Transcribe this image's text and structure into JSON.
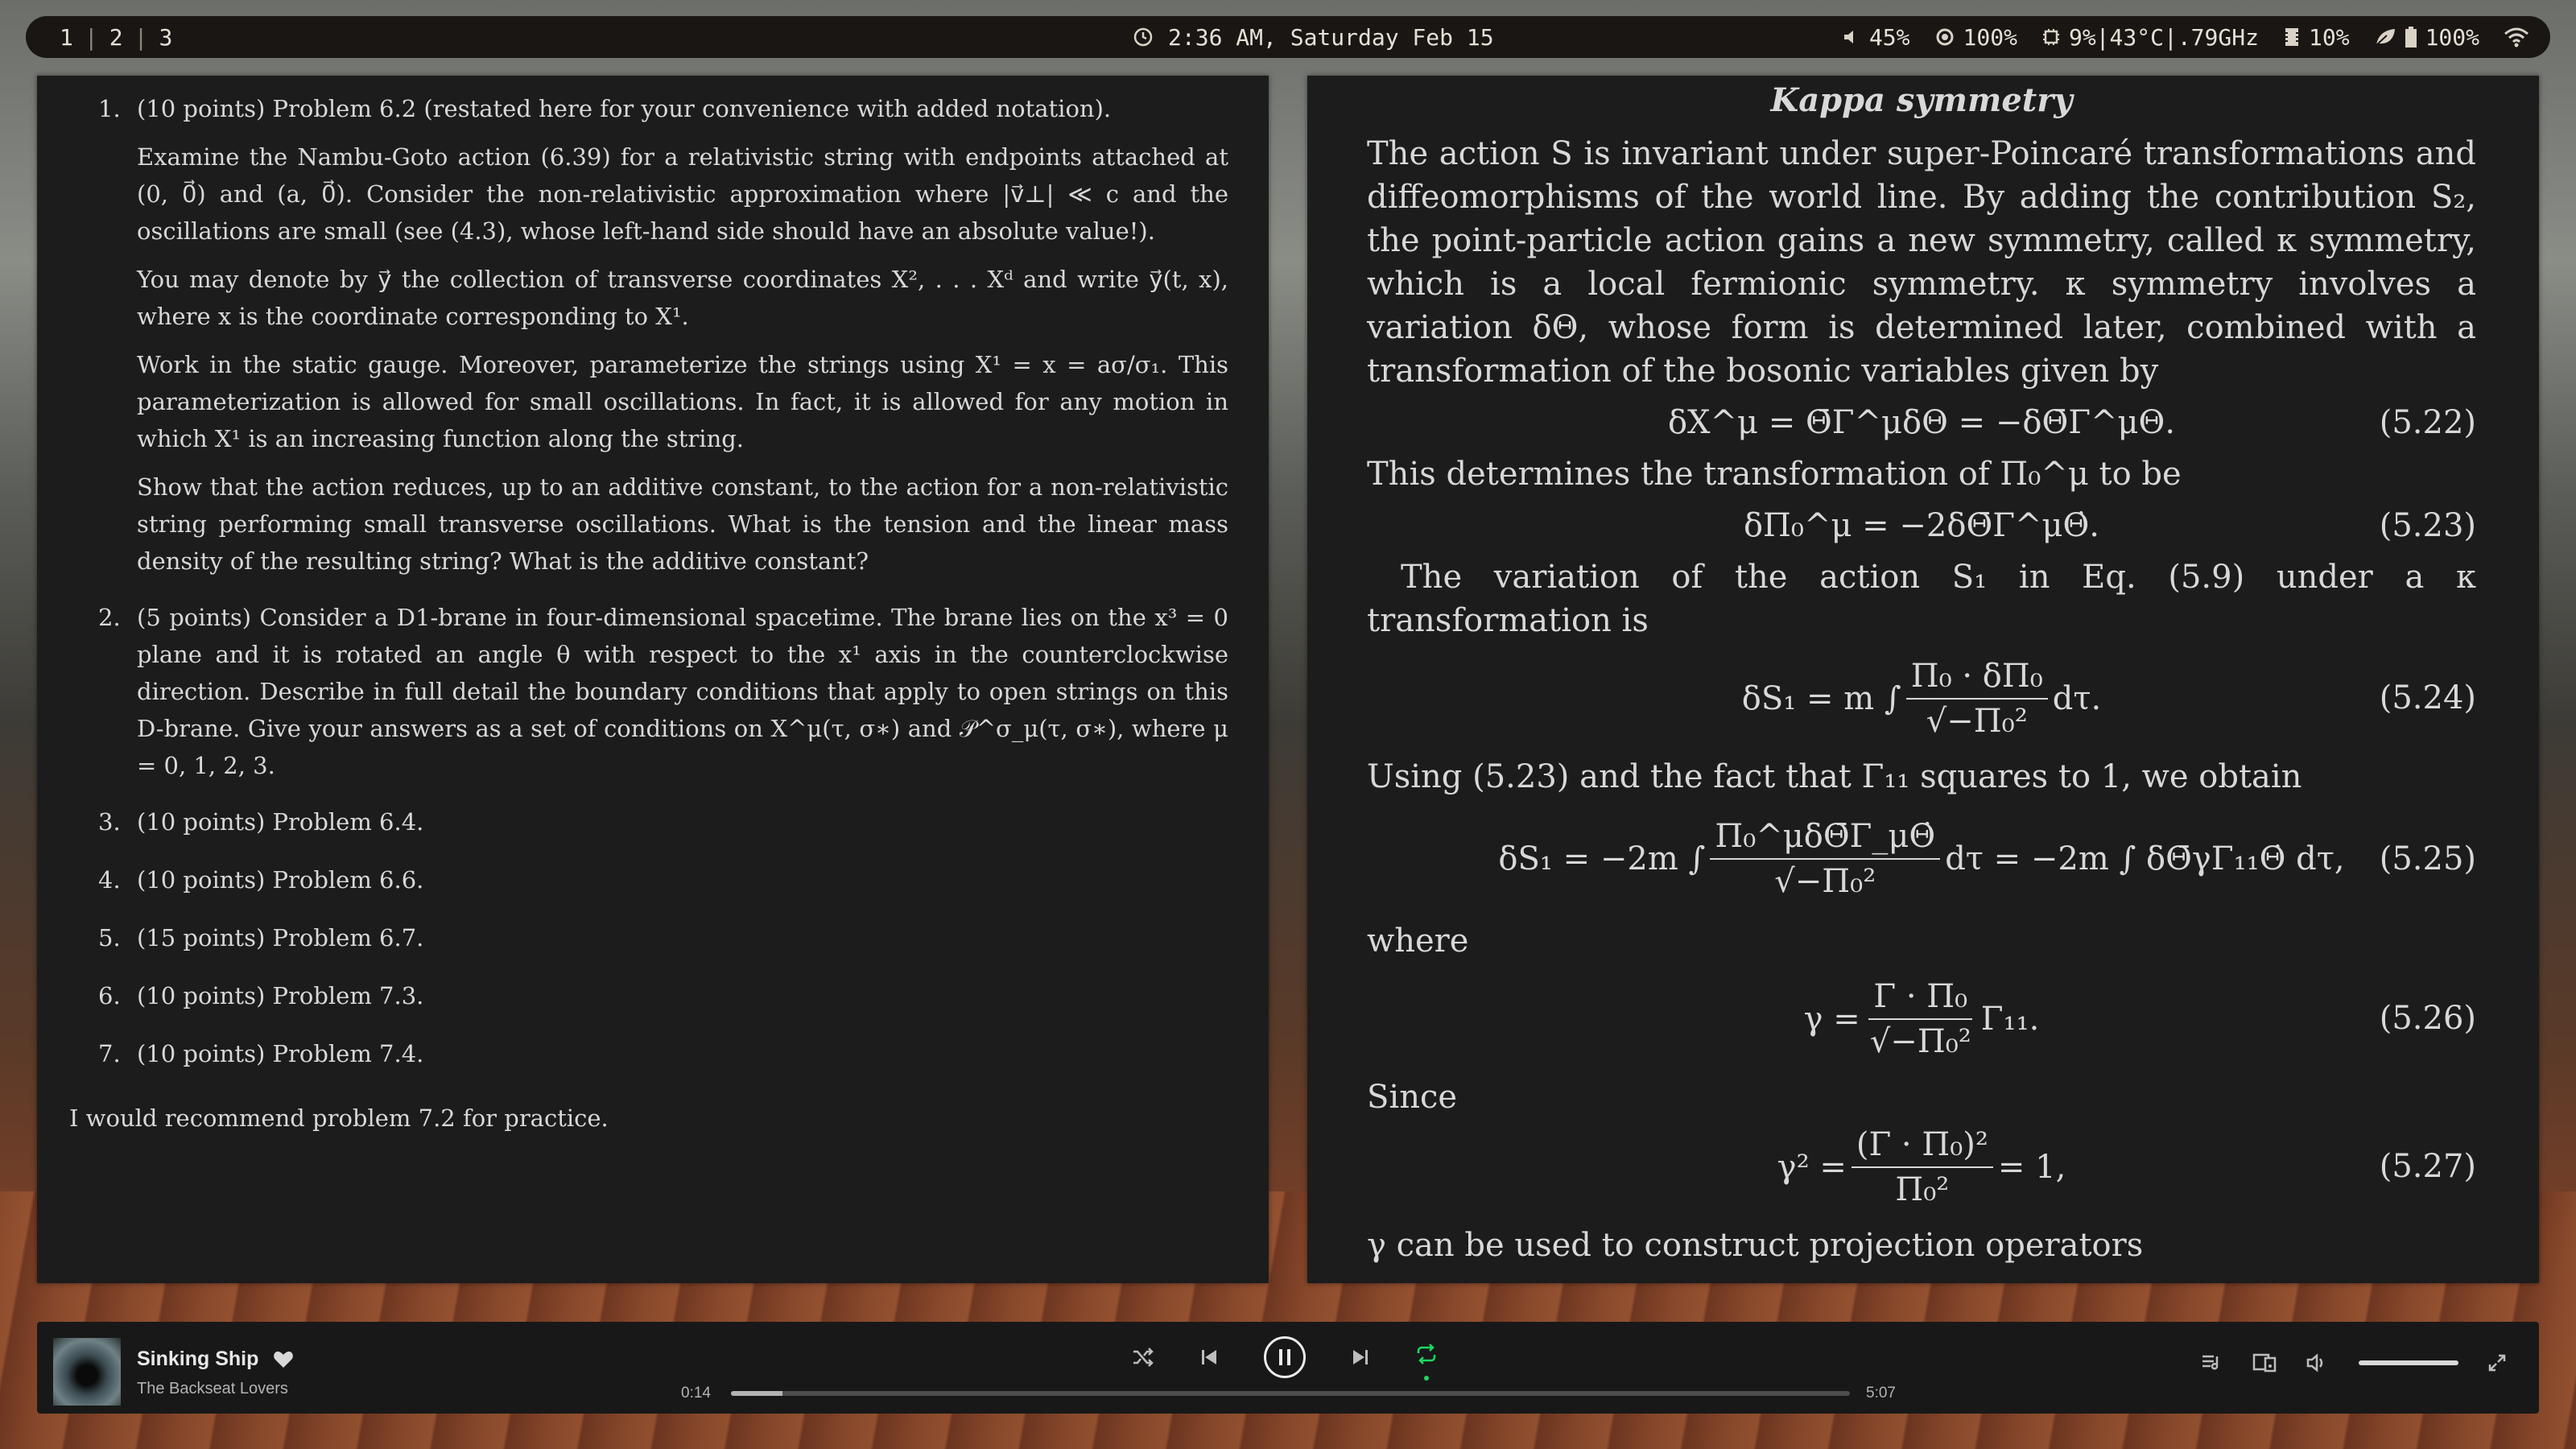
{
  "topbar": {
    "workspaces": [
      "1",
      "2",
      "3"
    ],
    "clock_icon": "clock-icon",
    "clock": "2:36 AM, Saturday Feb 15",
    "volume": "45%",
    "brightness": "100%",
    "cpu": "9%|43°C|.79GHz",
    "memory": "10%",
    "battery": "100%"
  },
  "left_doc": {
    "problems": [
      {
        "num": "1.",
        "paras": [
          "(10 points) Problem 6.2 (restated here for your convenience with added notation).",
          "Examine the Nambu-Goto action (6.39) for a relativistic string with endpoints attached at (0, 0⃗) and (a, 0⃗). Consider the non-relativistic approximation where |v⃗⊥| ≪ c and the oscillations are small (see (4.3), whose left-hand side should have an absolute value!).",
          "You may denote by y⃗ the collection of transverse coordinates X², . . . Xᵈ and write y⃗(t, x), where x is the coordinate corresponding to X¹.",
          "Work in the static gauge. Moreover, parameterize the strings using X¹ = x = aσ/σ₁. This parameterization is allowed for small oscillations. In fact, it is allowed for any motion in which X¹ is an increasing function along the string.",
          "Show that the action reduces, up to an additive constant, to the action for a non-relativistic string performing small transverse oscillations. What is the tension and the linear mass density of the resulting string? What is the additive constant?"
        ]
      },
      {
        "num": "2.",
        "paras": [
          "(5 points) Consider a D1-brane in four-dimensional spacetime. The brane lies on the x³ = 0 plane and it is rotated an angle θ with respect to the x¹ axis in the counterclockwise direction. Describe in full detail the boundary conditions that apply to open strings on this D-brane. Give your answers as a set of conditions on X^μ(τ, σ∗) and 𝒫^σ_μ(τ, σ∗), where μ = 0, 1, 2, 3."
        ]
      }
    ],
    "short_problems": [
      {
        "num": "3.",
        "text": "(10 points) Problem 6.4."
      },
      {
        "num": "4.",
        "text": "(10 points) Problem 6.6."
      },
      {
        "num": "5.",
        "text": "(15 points) Problem 6.7."
      },
      {
        "num": "6.",
        "text": "(10 points) Problem 7.3."
      },
      {
        "num": "7.",
        "text": "(10 points) Problem 7.4."
      }
    ],
    "recommend": "I would recommend problem 7.2 for practice."
  },
  "right_doc": {
    "title": "Kappa symmetry",
    "p1": "The action S is invariant under super-Poincaré transformations and diffeomorphisms of the world line. By adding the contribution S₂, the point-particle action gains a new symmetry, called κ symmetry, which is a local fermionic symmetry. κ symmetry involves a variation δΘ, whose form is determined later, combined with a transformation of the bosonic variables given by",
    "eq_522": "δX^μ = Θ̄Γ^μδΘ = −δΘ̄Γ^μΘ.",
    "tag_522": "(5.22)",
    "p2": "This determines the transformation of Π₀^μ to be",
    "eq_523": "δΠ₀^μ = −2δΘ̄Γ^μΘ̇.",
    "tag_523": "(5.23)",
    "p3": "The variation of the action S₁ in Eq. (5.9) under a κ transformation is",
    "eq_524_lhs": "δS₁ = m ∫",
    "eq_524_num": "Π₀ · δΠ₀",
    "eq_524_den": "√−Π₀²",
    "eq_524_rhs": "dτ.",
    "tag_524": "(5.24)",
    "p4": "Using (5.23) and the fact that Γ₁₁ squares to 1, we obtain",
    "eq_525_lhs": "δS₁ = −2m ∫",
    "eq_525_num": "Π₀^μδΘ̄Γ_μΘ̇",
    "eq_525_den": "√−Π₀²",
    "eq_525_rhs": "dτ = −2m ∫ δΘ̄γΓ₁₁Θ̇ dτ,",
    "tag_525": "(5.25)",
    "p5": "where",
    "eq_526_lhs": "γ =",
    "eq_526_num": "Γ · Π₀",
    "eq_526_den": "√−Π₀²",
    "eq_526_rhs": "Γ₁₁.",
    "tag_526": "(5.26)",
    "p6": "Since",
    "eq_527_lhs": "γ² =",
    "eq_527_num": "(Γ · Π₀)²",
    "eq_527_den": "Π₀²",
    "eq_527_rhs": "= 1,",
    "tag_527": "(5.27)",
    "p7": "γ can be used to construct projection operators"
  },
  "player": {
    "track": "Sinking Ship",
    "artist": "The Backseat Lovers",
    "elapsed": "0:14",
    "duration": "5:07",
    "progress_fraction": 0.046,
    "volume_fraction": 1.0
  }
}
